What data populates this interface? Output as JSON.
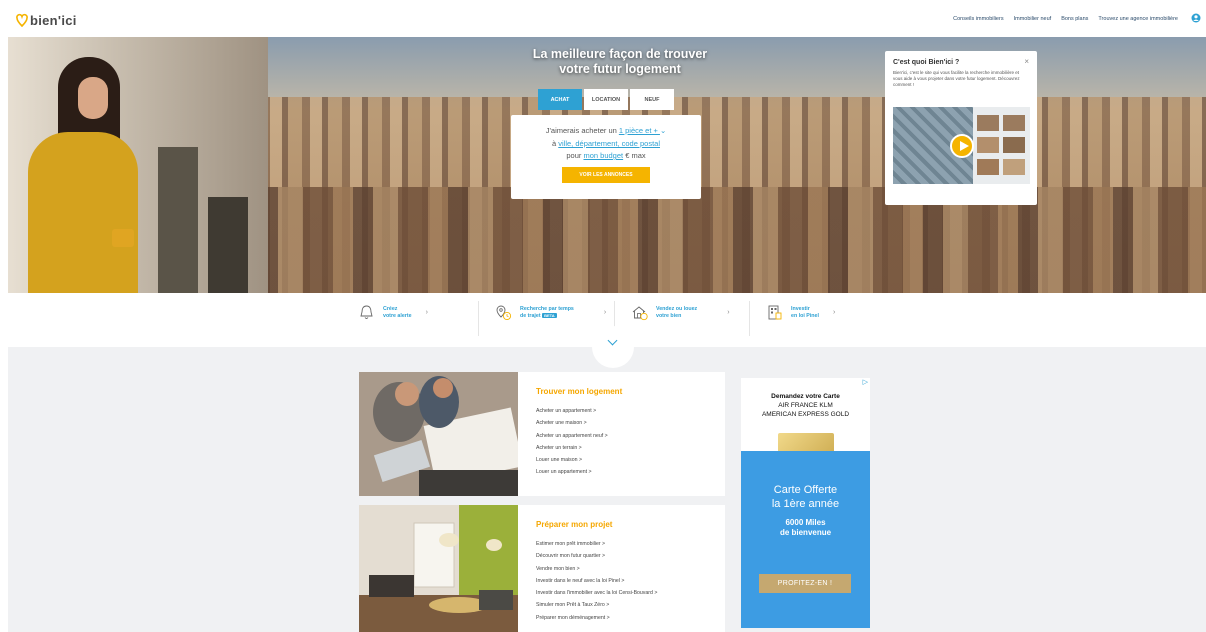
{
  "header": {
    "logo": "bien'ici",
    "nav": [
      "Conseils immobiliers",
      "Immobilier neuf",
      "Bons plans",
      "Trouvez une agence immobilière"
    ]
  },
  "hero": {
    "title_line1": "La meilleure façon de trouver",
    "title_line2": "votre futur logement",
    "tabs": [
      "ACHAT",
      "LOCATION",
      "NEUF"
    ],
    "active_tab": "ACHAT",
    "search": {
      "prefix1": "J'aimerais acheter un ",
      "rooms": "1 pièce et + ",
      "prefix2": "à ",
      "location": "ville, département, code postal ",
      "prefix3": "pour ",
      "budget": "mon budget",
      "suffix3": " € max",
      "button": "VOIR LES ANNONCES"
    }
  },
  "info_card": {
    "title": "C'est quoi Bien'ici ?",
    "close": "×",
    "text": "Bien'ici, c'est le site qui vous facilite la recherche immobilière et vous aide à vous projeter dans votre futur logement. Découvrez comment !"
  },
  "features": [
    {
      "line1": "Créez",
      "line2": "votre alerte",
      "icon": "bell-icon"
    },
    {
      "line1": "Recherche par temps",
      "line2": "de trajet",
      "badge": "BETA",
      "icon": "travel-time-icon"
    },
    {
      "line1": "Vendez ou louez",
      "line2": "votre bien",
      "icon": "house-euro-icon"
    },
    {
      "line1": "Investir",
      "line2": "en loi Pinel",
      "icon": "building-icon"
    }
  ],
  "cards": [
    {
      "title": "Trouver mon logement",
      "links": [
        "Acheter un appartement >",
        "Acheter une maison >",
        "Acheter un appartement neuf >",
        "Acheter un terrain >",
        "Louer une maison >",
        "Louer un appartement >"
      ]
    },
    {
      "title": "Préparer mon projet",
      "links": [
        "Estimer mon prêt immobilier >",
        "Découvrir mon futur quartier >",
        "Vendre mon bien >",
        "Investir dans le neuf avec la loi Pinel >",
        "Investir dans l'immobilier avec la loi Censi-Bouvard >",
        "Simuler mon Prêt à Taux Zéro >",
        "Préparer mon déménagement >"
      ]
    }
  ],
  "ad": {
    "line1": "Demandez votre Carte",
    "line2": "AIR FRANCE KLM",
    "line3": "AMERICAN EXPRESS GOLD",
    "offer1": "Carte Offerte",
    "offer2": "la 1ère année",
    "miles1": "6000 Miles",
    "miles2": "de bienvenue",
    "button": "PROFITEZ-EN !"
  },
  "colors": {
    "accent": "#2ea1d3",
    "brand_yellow": "#f5b400",
    "lower_bg": "#f0f1f3"
  }
}
